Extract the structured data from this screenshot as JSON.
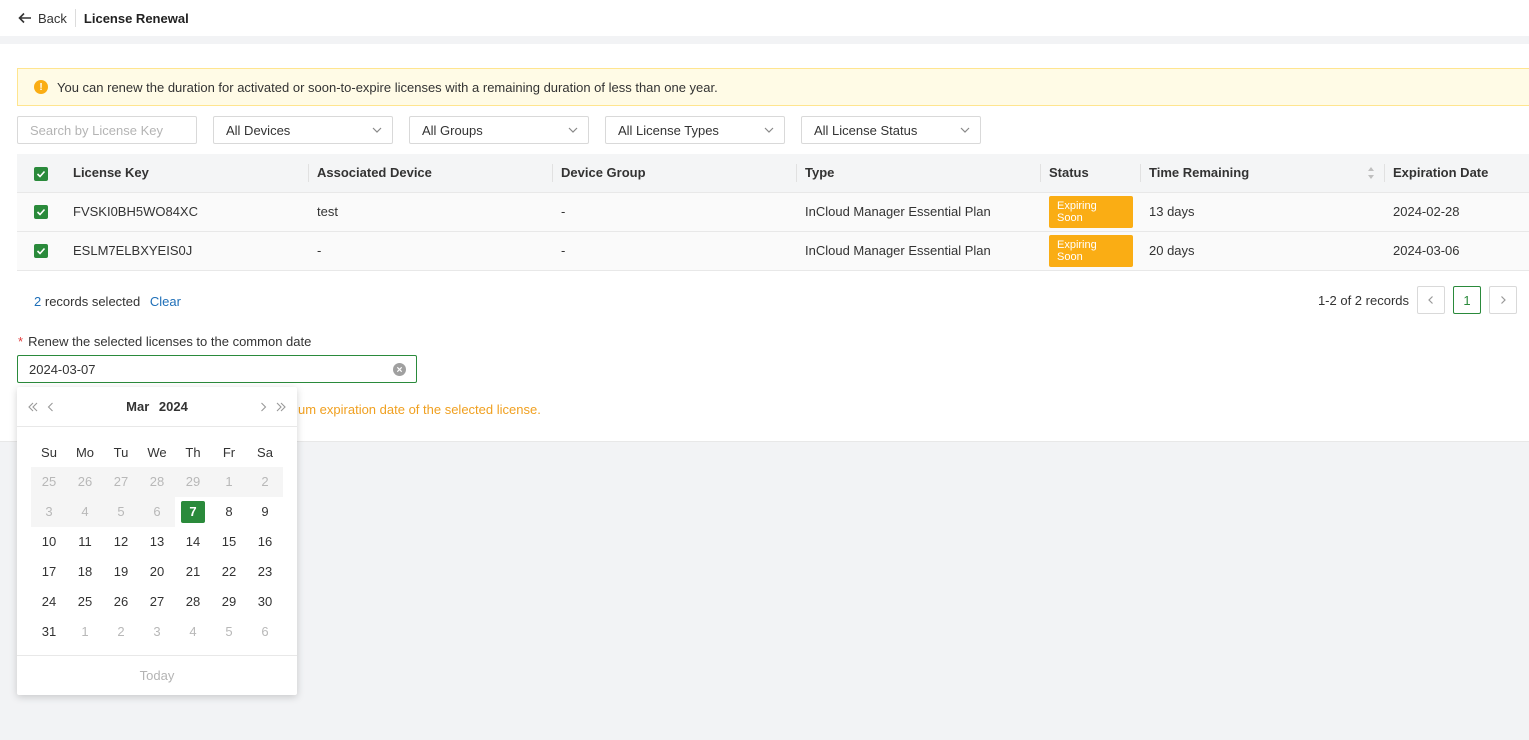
{
  "header": {
    "back_label": "Back",
    "title": "License Renewal"
  },
  "notice": {
    "text": "You can renew the duration for activated or soon-to-expire licenses with a remaining duration of less than one year."
  },
  "filters": {
    "search_placeholder": "Search by License Key",
    "devices": "All Devices",
    "groups": "All Groups",
    "license_types": "All License Types",
    "license_status": "All License Status"
  },
  "table": {
    "columns": [
      "License Key",
      "Associated Device",
      "Device Group",
      "Type",
      "Status",
      "Time Remaining",
      "Expiration Date"
    ],
    "rows": [
      {
        "key": "FVSKI0BH5WO84XC",
        "device": "test",
        "group": "-",
        "type": "InCloud Manager Essential Plan",
        "status": "Expiring Soon",
        "remaining": "13 days",
        "expiration": "2024-02-28"
      },
      {
        "key": "ESLM7ELBXYEIS0J",
        "device": "-",
        "group": "-",
        "type": "InCloud Manager Essential Plan",
        "status": "Expiring Soon",
        "remaining": "20 days",
        "expiration": "2024-03-06"
      }
    ]
  },
  "selection": {
    "count": "2",
    "text": "records selected",
    "clear_label": "Clear"
  },
  "pagination": {
    "summary": "1-2 of 2 records",
    "current_page": "1"
  },
  "renew": {
    "label": "Renew the selected licenses to the common date",
    "required_mark": "*",
    "value": "2024-03-07",
    "hint": "um expiration date of the selected license."
  },
  "datepicker": {
    "month": "Mar",
    "year": "2024",
    "weekdays": [
      "Su",
      "Mo",
      "Tu",
      "We",
      "Th",
      "Fr",
      "Sa"
    ],
    "weeks": [
      [
        "25",
        "26",
        "27",
        "28",
        "29",
        "1",
        "2"
      ],
      [
        "3",
        "4",
        "5",
        "6",
        "7",
        "8",
        "9"
      ],
      [
        "10",
        "11",
        "12",
        "13",
        "14",
        "15",
        "16"
      ],
      [
        "17",
        "18",
        "19",
        "20",
        "21",
        "22",
        "23"
      ],
      [
        "24",
        "25",
        "26",
        "27",
        "28",
        "29",
        "30"
      ],
      [
        "31",
        "1",
        "2",
        "3",
        "4",
        "5",
        "6"
      ]
    ],
    "selected_day": "7",
    "today_label": "Today"
  },
  "colors": {
    "accent": "#2a8a3b",
    "warning": "#faad14",
    "link": "#1e6fb8"
  }
}
